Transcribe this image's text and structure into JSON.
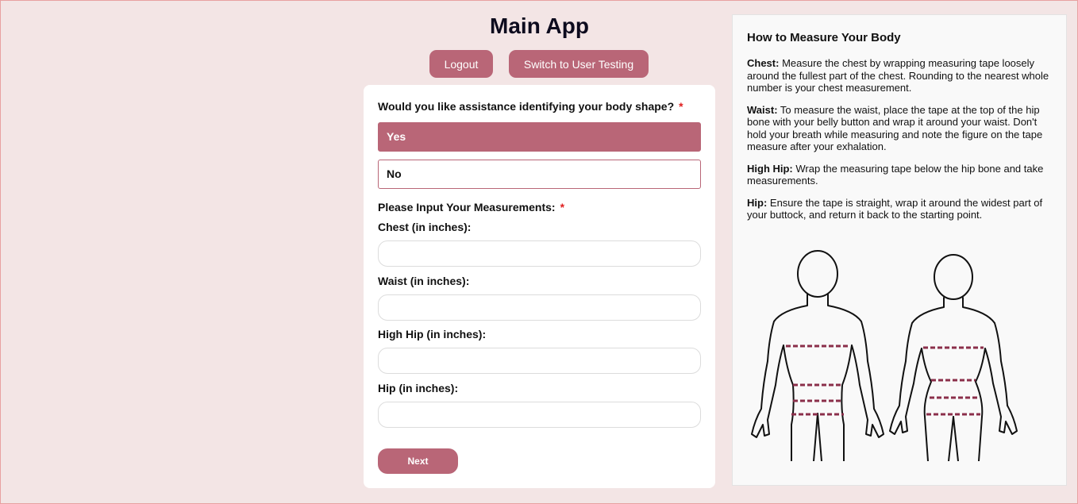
{
  "header": {
    "title": "Main App",
    "logout_label": "Logout",
    "switch_label": "Switch to User Testing"
  },
  "form": {
    "question": "Would you like assistance identifying your body shape?",
    "required_mark": "*",
    "options": [
      {
        "label": "Yes",
        "selected": true
      },
      {
        "label": "No",
        "selected": false
      }
    ],
    "measurements_heading": "Please Input Your Measurements:",
    "fields": [
      {
        "label": "Chest (in inches):",
        "value": ""
      },
      {
        "label": "Waist (in inches):",
        "value": ""
      },
      {
        "label": "High Hip (in inches):",
        "value": ""
      },
      {
        "label": "Hip (in inches):",
        "value": ""
      }
    ],
    "next_label": "Next"
  },
  "guide": {
    "title": "How to Measure Your Body",
    "sections": [
      {
        "term": "Chest:",
        "text": " Measure the chest by wrapping measuring tape loosely around the fullest part of the chest. Rounding to the nearest whole number is your chest measurement."
      },
      {
        "term": "Waist:",
        "text": " To measure the waist, place the tape at the top of the hip bone with your belly button and wrap it around your waist. Don't hold your breath while measuring and note the figure on the tape measure after your exhalation."
      },
      {
        "term": "High Hip:",
        "text": " Wrap the measuring tape below the hip bone and take measurements."
      },
      {
        "term": "Hip:",
        "text": " Ensure the tape is straight, wrap it around the widest part of your buttock, and return it back to the starting point."
      }
    ]
  },
  "colors": {
    "accent": "#b96677",
    "background": "#f3e5e5",
    "measure_line": "#8b2f4a"
  }
}
